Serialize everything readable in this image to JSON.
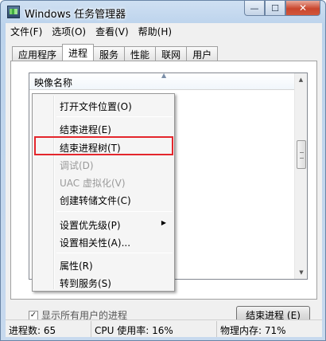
{
  "window": {
    "title": "Windows 任务管理器"
  },
  "caption_buttons": {
    "minimize": "—",
    "maximize": "☐",
    "close": "✕"
  },
  "menubar": {
    "items": [
      "文件(F)",
      "选项(O)",
      "查看(V)",
      "帮助(H)"
    ]
  },
  "tabs": [
    {
      "label": "应用程序",
      "active": false
    },
    {
      "label": "进程",
      "active": true
    },
    {
      "label": "服务",
      "active": false
    },
    {
      "label": "性能",
      "active": false
    },
    {
      "label": "联网",
      "active": false
    },
    {
      "label": "用户",
      "active": false
    }
  ],
  "list": {
    "column_header": "映像名称"
  },
  "checkbox": {
    "checked": true,
    "label": "显示所有用户的进程"
  },
  "end_process_button": "结束进程 (E)",
  "status": {
    "processes": "进程数: 65",
    "cpu": "CPU 使用率: 16%",
    "memory": "物理内存: 71%"
  },
  "context_menu": {
    "items": [
      {
        "label": "打开文件位置(O)",
        "disabled": false
      },
      {
        "label": "结束进程(E)",
        "disabled": false
      },
      {
        "label": "结束进程树(T)",
        "disabled": false,
        "highlighted": true
      },
      {
        "label": "调试(D)",
        "disabled": true
      },
      {
        "label": "UAC 虚拟化(V)",
        "disabled": true
      },
      {
        "label": "创建转储文件(C)",
        "disabled": false
      },
      {
        "label": "设置优先级(P)",
        "disabled": false,
        "submenu": true
      },
      {
        "label": "设置相关性(A)...",
        "disabled": false
      },
      {
        "label": "属性(R)",
        "disabled": false
      },
      {
        "label": "转到服务(S)",
        "disabled": false
      }
    ]
  },
  "colors": {
    "highlight_border": "#e4262c"
  }
}
